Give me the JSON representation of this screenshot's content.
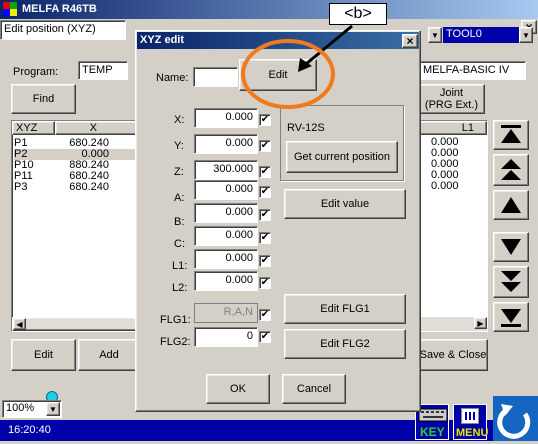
{
  "titlebar": {
    "title": "MELFA R46TB",
    "close": "×"
  },
  "left_window": {
    "mode_select": "Edit position (XYZ)",
    "program_label": "Program:",
    "program_value": "TEMP",
    "find_button": "Find",
    "table_headers": [
      "XYZ",
      "X"
    ],
    "rows": [
      {
        "name": "P1",
        "x": "680.240"
      },
      {
        "name": "P2",
        "x": "0.000"
      },
      {
        "name": "P10",
        "x": "880.240"
      },
      {
        "name": "P11",
        "x": "680.240"
      },
      {
        "name": "P3",
        "x": "680.240"
      }
    ],
    "edit_button": "Edit",
    "add_button": "Add",
    "zoom_value": "100%",
    "time": "16:20:40"
  },
  "right_window": {
    "tool_select": "TOOL0",
    "language": "MELFA-BASIC IV",
    "joint_button_line1": "Joint",
    "joint_button_line2": "(PRG Ext.)",
    "column_header": "L1",
    "values": [
      "0.000",
      "0.000",
      "0.000",
      "0.000",
      "0.000"
    ],
    "save_close_button": "Save & Close",
    "key_label": "KEY",
    "menu_label": "MENU"
  },
  "dialog": {
    "title": "XYZ edit",
    "close": "×",
    "name_label": "Name:",
    "name_value": "",
    "edit_button": "Edit",
    "robot_model": "RV-12S",
    "get_position_button": "Get current position",
    "edit_value_button": "Edit value",
    "edit_flg1_button": "Edit FLG1",
    "edit_flg2_button": "Edit FLG2",
    "ok_button": "OK",
    "cancel_button": "Cancel",
    "fields": [
      {
        "label": "X:",
        "value": "0.000",
        "checked": true
      },
      {
        "label": "Y:",
        "value": "0.000",
        "checked": true
      },
      {
        "label": "Z:",
        "value": "300.000",
        "checked": true
      },
      {
        "label": "A:",
        "value": "0.000",
        "checked": true
      },
      {
        "label": "B:",
        "value": "0.000",
        "checked": true
      },
      {
        "label": "C:",
        "value": "0.000",
        "checked": true
      },
      {
        "label": "L1:",
        "value": "0.000",
        "checked": true
      },
      {
        "label": "L2:",
        "value": "0.000",
        "checked": true
      },
      {
        "label": "FLG1:",
        "value": "R,A,N",
        "checked": true
      },
      {
        "label": "FLG2:",
        "value": "0",
        "checked": true
      }
    ]
  },
  "annotation": {
    "label": "<b>",
    "color": "#f07a1c"
  }
}
